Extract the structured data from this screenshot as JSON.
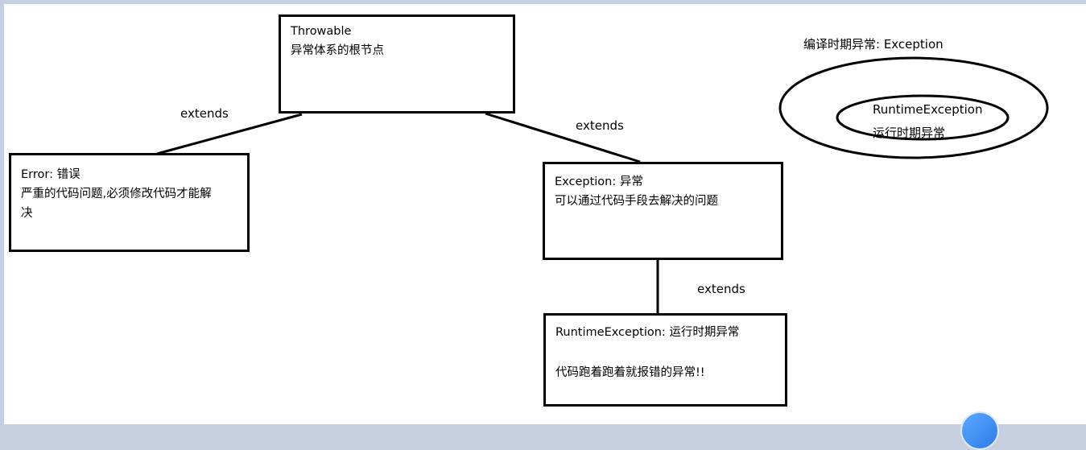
{
  "throwable": {
    "title": "Throwable",
    "desc": "异常体系的根节点"
  },
  "error": {
    "title": "Error: 错误",
    "desc": "严重的代码问题,必须修改代码才能解决"
  },
  "exception": {
    "title": "Exception: 异常",
    "desc": "可以通过代码手段去解决的问题"
  },
  "runtime": {
    "title": "RuntimeException: 运行时期异常",
    "desc": "代码跑着跑着就报错的异常!!"
  },
  "edges": {
    "e1": "extends",
    "e2": "extends",
    "e3": "extends"
  },
  "venn": {
    "outer": "编译时期异常: Exception",
    "inner_title": "RuntimeException",
    "inner_desc": "运行时期异常"
  }
}
